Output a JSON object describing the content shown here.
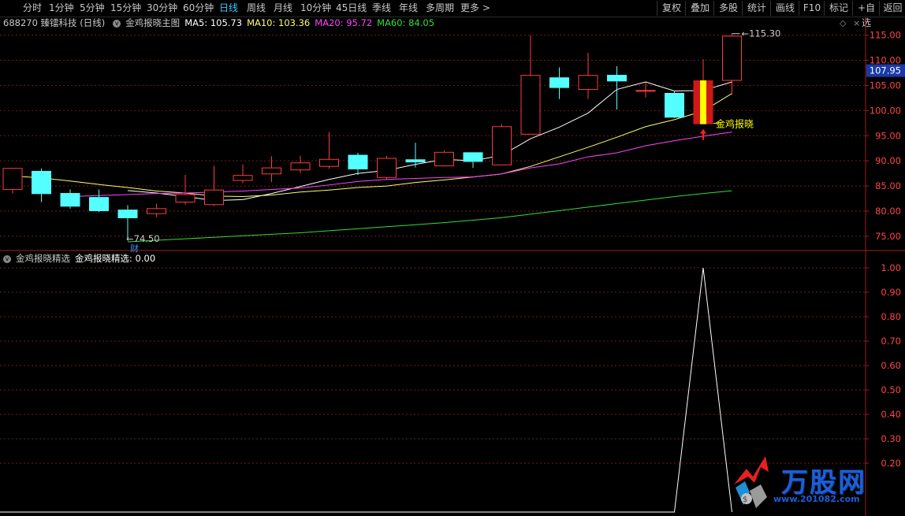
{
  "toolbar": {
    "periods": [
      "分时",
      "1分钟",
      "5分钟",
      "15分钟",
      "30分钟",
      "60分钟",
      "日线",
      "周线",
      "月线",
      "10分钟",
      "45日线",
      "季线",
      "年线",
      "多周期",
      "更多 >"
    ],
    "active_period": "日线",
    "right_buttons": [
      "复权",
      "叠加",
      "多股",
      "统计",
      "画线",
      "F10",
      "标记",
      "+自选",
      "返回"
    ]
  },
  "main_info": {
    "stock": "688270 臻镭科技 (日线)",
    "indicator": "金鸡报晓主图",
    "ma5": "MA5: 105.73",
    "ma10": "MA10: 103.36",
    "ma20": "MA20: 95.72",
    "ma60": "MA60: 84.05"
  },
  "sub_info": {
    "name": "金鸡报晓精选",
    "value": "金鸡报晓精选: 0.00"
  },
  "price_axis_labels": [
    "115.00",
    "110.00",
    "105.00",
    "100.00",
    "95.00",
    "90.00",
    "85.00",
    "80.00",
    "75.00"
  ],
  "current_price": "107.95",
  "sub_axis_labels": [
    "1.00",
    "0.90",
    "0.80",
    "0.70",
    "0.60",
    "0.50",
    "0.40",
    "0.30",
    "0.20"
  ],
  "annotations": {
    "high_label": "115.30",
    "low_label": "74.50",
    "fin_marker": "财",
    "signal_label": "金鸡报晓"
  },
  "colors": {
    "up": "#ff3b3b",
    "down": "#54ffff",
    "ma5": "#ffffff",
    "ma10": "#ffff66",
    "ma20": "#ff44ff",
    "ma60": "#33dd33",
    "grid": "#7a1a1a",
    "axis_text": "#ff4444",
    "current_price_bg": "#1a3aa8",
    "active_period": "#3cc8ff"
  },
  "logo": {
    "name": "万股网",
    "url": "www.201082.com"
  },
  "chart_data": [
    {
      "type": "candlestick",
      "title": "688270 臻镭科技 (日线)",
      "ylim": [
        72.0,
        116.9
      ],
      "y_ticks": [
        75,
        80,
        85,
        90,
        95,
        100,
        105,
        110,
        115
      ],
      "grid": true,
      "candles": [
        {
          "o": 84.3,
          "h": 88.6,
          "l": 83.5,
          "c": 88.5
        },
        {
          "o": 88.0,
          "h": 88.5,
          "l": 81.8,
          "c": 83.4
        },
        {
          "o": 83.6,
          "h": 84.3,
          "l": 80.5,
          "c": 80.9
        },
        {
          "o": 82.8,
          "h": 84.3,
          "l": 79.8,
          "c": 80.0
        },
        {
          "o": 80.3,
          "h": 81.2,
          "l": 74.5,
          "c": 78.6
        },
        {
          "o": 79.5,
          "h": 81.5,
          "l": 78.8,
          "c": 80.5
        },
        {
          "o": 81.8,
          "h": 87.2,
          "l": 81.3,
          "c": 83.3
        },
        {
          "o": 81.3,
          "h": 89.0,
          "l": 81.0,
          "c": 84.2
        },
        {
          "o": 86.1,
          "h": 89.3,
          "l": 85.6,
          "c": 87.1
        },
        {
          "o": 87.4,
          "h": 90.9,
          "l": 85.8,
          "c": 88.6
        },
        {
          "o": 88.2,
          "h": 91.0,
          "l": 87.6,
          "c": 89.6
        },
        {
          "o": 88.9,
          "h": 95.7,
          "l": 88.4,
          "c": 90.3
        },
        {
          "o": 91.2,
          "h": 91.6,
          "l": 87.2,
          "c": 88.3
        },
        {
          "o": 86.7,
          "h": 91.0,
          "l": 86.3,
          "c": 90.5
        },
        {
          "o": 90.3,
          "h": 93.6,
          "l": 88.7,
          "c": 89.7
        },
        {
          "o": 89.0,
          "h": 92.1,
          "l": 88.9,
          "c": 91.7
        },
        {
          "o": 91.7,
          "h": 91.7,
          "l": 88.6,
          "c": 89.8
        },
        {
          "o": 89.2,
          "h": 97.3,
          "l": 89.1,
          "c": 96.8
        },
        {
          "o": 95.3,
          "h": 115.0,
          "l": 95.3,
          "c": 107.0
        },
        {
          "o": 106.6,
          "h": 108.6,
          "l": 102.3,
          "c": 104.5
        },
        {
          "o": 104.2,
          "h": 111.5,
          "l": 102.3,
          "c": 107.0
        },
        {
          "o": 107.1,
          "h": 108.8,
          "l": 100.2,
          "c": 105.8
        },
        {
          "o": 104.0,
          "h": 105.6,
          "l": 102.6,
          "c": 104.0
        },
        {
          "o": 103.5,
          "h": 104.0,
          "l": 98.5,
          "c": 98.6
        },
        {
          "o": 97.3,
          "h": 110.2,
          "l": 97.3,
          "c": 106.0
        },
        {
          "o": 106.0,
          "h": 115.3,
          "l": 103.1,
          "c": 114.8
        }
      ],
      "signal_candle_index": 24,
      "series": [
        {
          "name": "MA5",
          "values": [
            null,
            null,
            null,
            null,
            84.1,
            83.6,
            82.9,
            82.1,
            82.3,
            83.5,
            84.9,
            86.3,
            87.5,
            88.1,
            89.3,
            90.3,
            90.0,
            91.1,
            94.4,
            96.7,
            99.5,
            104.2,
            105.7,
            103.9,
            104.0,
            105.7
          ]
        },
        {
          "name": "MA10",
          "values": [
            87.0,
            86.6,
            86.0,
            85.3,
            84.7,
            84.0,
            83.6,
            83.0,
            82.9,
            83.2,
            83.8,
            84.2,
            84.7,
            85.0,
            85.7,
            86.2,
            86.8,
            87.4,
            88.9,
            90.8,
            92.7,
            94.7,
            96.8,
            98.2,
            99.9,
            103.4
          ]
        },
        {
          "name": "MA20",
          "values": [
            82.9,
            83.1,
            83.3,
            83.5,
            83.6,
            83.8,
            84.0,
            84.3,
            84.6,
            85.2,
            85.9,
            86.3,
            86.5,
            86.7,
            86.8,
            87.4,
            88.6,
            89.4,
            90.8,
            91.6,
            93.0,
            94.0,
            94.9,
            95.72
          ]
        },
        {
          "name": "MA60",
          "values": [
            73.9,
            74.2,
            74.5,
            74.8,
            75.1,
            75.4,
            75.7,
            76.1,
            76.5,
            76.9,
            77.3,
            77.7,
            78.2,
            78.7,
            79.4,
            80.1,
            80.8,
            81.5,
            82.2,
            82.9,
            83.5,
            84.05
          ]
        }
      ]
    },
    {
      "type": "line",
      "title": "金鸡报晓精选",
      "ylim": [
        0,
        1.05
      ],
      "y_ticks": [
        0.2,
        0.3,
        0.4,
        0.5,
        0.6,
        0.7,
        0.8,
        0.9,
        1.0
      ],
      "grid": true,
      "series": [
        {
          "name": "金鸡报晓精选",
          "values": [
            0,
            0,
            0,
            0,
            0,
            0,
            0,
            0,
            0,
            0,
            0,
            0,
            0,
            0,
            0,
            0,
            0,
            0,
            0,
            0,
            0,
            0,
            0,
            0,
            1,
            0
          ]
        }
      ]
    }
  ]
}
